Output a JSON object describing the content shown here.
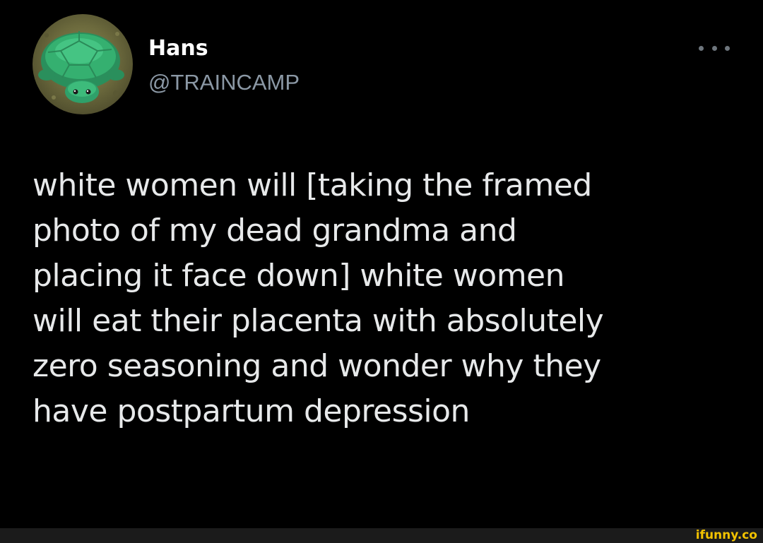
{
  "tweet": {
    "author": {
      "display_name": "Hans",
      "handle": "@TRAINCAMP",
      "avatar_icon": "green-turtle-sandbox-avatar"
    },
    "more_icon": "more-horizontal-icon",
    "text": "white women will  [taking the framed\nphoto of my dead grandma and\nplacing it face down]  white women\nwill eat their placenta with absolutely\nzero seasoning and wonder why they\nhave postpartum depression"
  },
  "watermark": {
    "text": "ifunny.co",
    "color": "#f2c200"
  },
  "colors": {
    "background": "#000000",
    "primary_text": "#e7e9ea",
    "secondary_text": "#8b98a5",
    "avatar_green": "#2fa06a"
  }
}
